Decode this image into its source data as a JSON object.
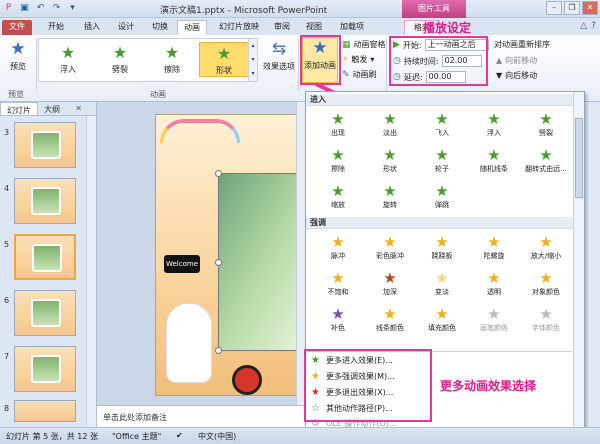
{
  "window": {
    "title": "演示文稿1.pptx - Microsoft PowerPoint",
    "context_tool": "图片工具"
  },
  "tabs": [
    "文件",
    "开始",
    "插入",
    "设计",
    "切换",
    "动画",
    "幻灯片放映",
    "审阅",
    "视图",
    "加载项",
    "格式"
  ],
  "ribbon": {
    "preview": {
      "label": "预览",
      "group_label": "预览"
    },
    "gallery_items": [
      "浮入",
      "劈裂",
      "擦除",
      "形状"
    ],
    "effect_options": "效果选项",
    "group_animation": "动画",
    "add_animation": "添加动画",
    "animation_pane": "动画窗格",
    "trigger": "触发",
    "animation_painter": "动画刷",
    "start_label": "开始:",
    "start_value": "上一动画之后",
    "duration_label": "持续时间:",
    "duration_value": "02.00",
    "delay_label": "延迟:",
    "delay_value": "00.00",
    "reorder": "对动画重新排序",
    "move_earlier": "向前移动",
    "move_later": "向后移动"
  },
  "annotations": {
    "playback": "播放设定",
    "more_effects": "更多动画效果选择"
  },
  "left_pane": {
    "tabs": [
      "幻灯片",
      "大纲"
    ],
    "slides": [
      "3",
      "4",
      "5",
      "6",
      "7",
      "8"
    ],
    "selected": "5"
  },
  "notes_placeholder": "单击此处添加备注",
  "dropdown": {
    "entrance_header": "进入",
    "entrance": [
      "出现",
      "淡出",
      "飞入",
      "浮入",
      "劈裂",
      "擦除",
      "形状",
      "轮子",
      "随机线条",
      "翻转式由远...",
      "缩放",
      "旋转",
      "弹跳"
    ],
    "emphasis_header": "强调",
    "emphasis": [
      "脉冲",
      "彩色脉冲",
      "跷跷板",
      "陀螺旋",
      "放大/缩小",
      "不饱和",
      "加深",
      "变淡",
      "透明",
      "对象颜色",
      "补色",
      "线条颜色",
      "填充颜色",
      "画笔颜色",
      "字体颜色"
    ],
    "more": [
      {
        "label": "更多进入效果(E)...",
        "color": "#3a9a2e",
        "enabled": true
      },
      {
        "label": "更多强调效果(M)...",
        "color": "#e8b21e",
        "enabled": true
      },
      {
        "label": "更多退出效果(X)...",
        "color": "#d6332a",
        "enabled": true
      },
      {
        "label": "其他动作路径(P)...",
        "color": "#666666",
        "enabled": true
      },
      {
        "label": "OLE 操作动作(O)...",
        "color": "#aaaaaa",
        "enabled": false
      }
    ]
  },
  "status": {
    "slide_info": "幻灯片 第 5 张，共 12 张",
    "theme": "\"Office 主题\"",
    "lang": "中文(中国)"
  },
  "slide": {
    "welcome_text": "Welcome"
  }
}
